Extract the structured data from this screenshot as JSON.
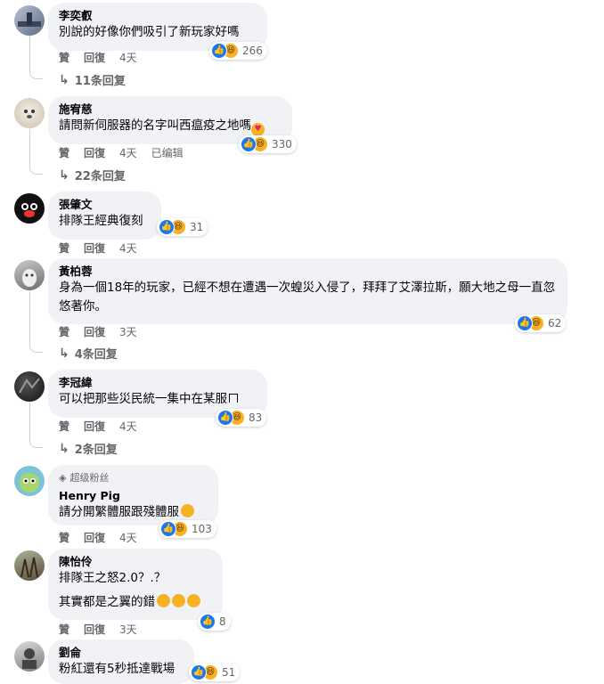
{
  "labels": {
    "like": "贊",
    "reply": "回復",
    "edited": "已編輯"
  },
  "comments": [
    {
      "name": "李奕叡",
      "text": "別說的好像你們吸引了新玩家好嗎",
      "reactions": "266",
      "time": "4天",
      "replies": "11条回复"
    },
    {
      "name": "施宥慈",
      "text": "請問新伺服器的名字叫西瘟疫之地嗎",
      "emoji": "heart-eyes",
      "reactions": "330",
      "time": "4天",
      "edited": "已编辑",
      "replies": "22条回复"
    },
    {
      "name": "張肇文",
      "text": "排隊王經典復刻",
      "reactions": "31",
      "time": "4天"
    },
    {
      "name": "黃柏蓉",
      "text": "身為一個18年的玩家，已經不想在遭遇一次蝗災入侵了，拜拜了艾澤拉斯，願大地之母一直忽悠著你。",
      "reactions": "62",
      "time": "3天",
      "replies": "4条回复"
    },
    {
      "name": "李冠緯",
      "text": "可以把那些災民統一集中在某服",
      "reactions": "83",
      "time": "4天",
      "replies": "2条回复"
    },
    {
      "badge": "超级粉丝",
      "name": "Henry Pig",
      "text": "請分開繁體服跟殘體服",
      "emoji": "crying-laughing",
      "reactions": "103",
      "time": "4天"
    },
    {
      "name": "陳怡伶",
      "text": "排隊王之怒2.0？.？",
      "text2": "其實都是之翼的錯",
      "reactions": "8",
      "time": "3天"
    },
    {
      "name": "劉侖",
      "text": "粉紅還有5秒抵達戰場",
      "reactions": "51"
    }
  ],
  "colors": {
    "like": "#1877f2",
    "haha": "#f7b125",
    "bubble": "#f0f2f5",
    "secondary": "#65676b"
  }
}
